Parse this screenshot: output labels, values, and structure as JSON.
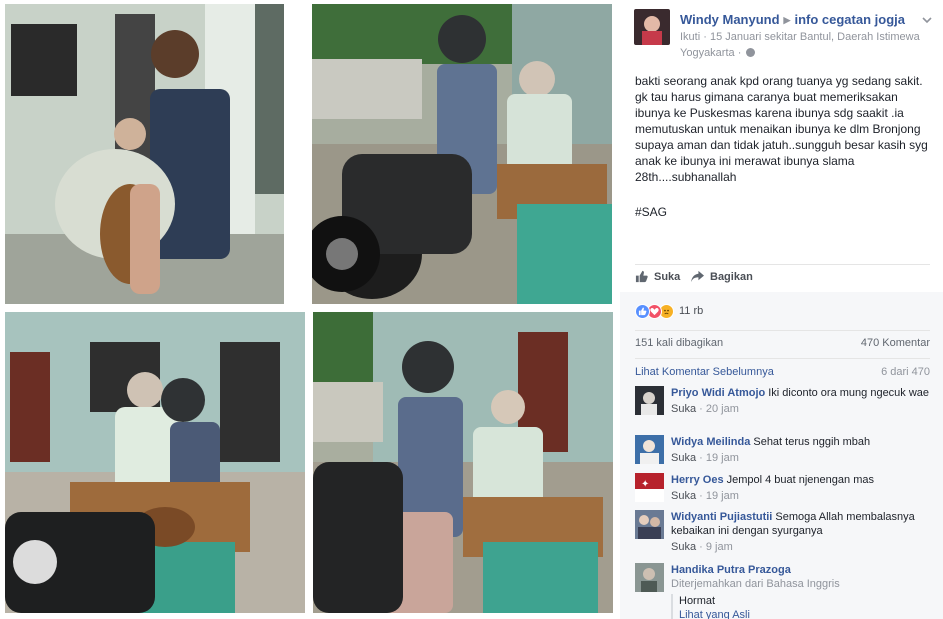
{
  "post": {
    "author": "Windy Manyund",
    "target": "info cegatan jogja",
    "follow_label": "Ikuti",
    "date_location": "15 Januari sekitar Bantul, Daerah Istimewa Yogyakarta",
    "separator": "·",
    "body": "bakti seorang anak kpd orang tuanya yg sedang sakit. gk tau harus gimana caranya buat memeriksakan ibunya ke Puskesmas karena ibunya sdg saakit .ia memutuskan untuk menaikan ibunya ke dlm Bronjong supaya aman dan tidak jatuh..sungguh besar kasih syg anak ke ibunya ini merawat ibunya slama 28th....subhanallah",
    "hashtag": "#SAG"
  },
  "actions": {
    "like_label": "Suka",
    "share_label": "Bagikan"
  },
  "reactions": {
    "count": "11 rb",
    "types": [
      "like-icon",
      "love-icon",
      "sad-icon"
    ]
  },
  "stats": {
    "shares": "151 kali dibagikan",
    "comments": "470 Komentar"
  },
  "comments_header": {
    "previous_link": "Lihat Komentar Sebelumnya",
    "position": "6 dari 470"
  },
  "comments": [
    {
      "name": "Priyo Widi Atmojo",
      "text": "Iki diconto ora mung ngecuk wae",
      "like_label": "Suka",
      "time": "20 jam"
    },
    {
      "name": "Widya Meilinda",
      "text": "Sehat terus nggih mbah",
      "like_label": "Suka",
      "time": "19 jam"
    },
    {
      "name": "Herry Oes",
      "text": "Jempol 4 buat njenengan mas",
      "like_label": "Suka",
      "time": "19 jam"
    },
    {
      "name": "Widyanti Pujiastutii",
      "text": "Semoga Allah membalasnya kebaikan ini dengan syurganya",
      "like_label": "Suka",
      "time": "9 jam"
    },
    {
      "name": "Handika Putra Prazoga",
      "translated": "Diterjemahkan dari Bahasa Inggris",
      "text": "Hormat",
      "original_link": "Lihat yang Asli"
    }
  ],
  "colors": {
    "link": "#365899",
    "meta": "#90949c",
    "feedback_bg": "#f6f7f9",
    "like_blue": "#5890ff",
    "love_red": "#f25268",
    "sad_yellow": "#f7b125"
  }
}
